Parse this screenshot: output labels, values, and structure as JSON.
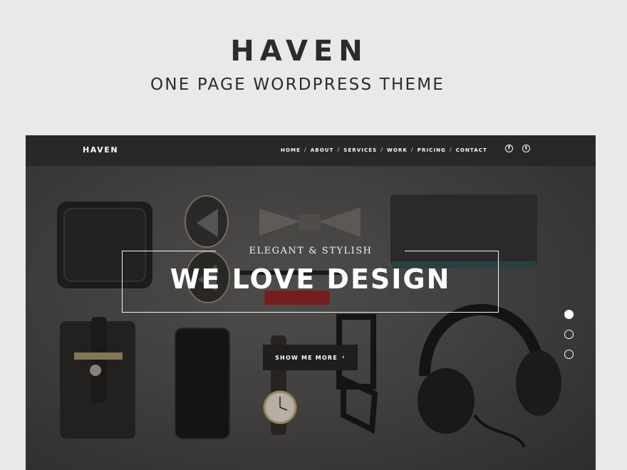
{
  "promo": {
    "title": "HAVEN",
    "subtitle": "ONE PAGE WORDPRESS THEME"
  },
  "site": {
    "logo": "HAVEN",
    "nav": {
      "items": [
        {
          "label": "HOME"
        },
        {
          "label": "ABOUT"
        },
        {
          "label": "SERVICES"
        },
        {
          "label": "WORK"
        },
        {
          "label": "PRICING"
        },
        {
          "label": "CONTACT"
        }
      ],
      "separator": "/"
    },
    "social": {
      "facebook_glyph": "f",
      "twitter_glyph": "t",
      "icons": [
        "facebook-icon",
        "twitter-icon"
      ]
    },
    "hero": {
      "tagline": "ELEGANT & STYLISH",
      "headline": "WE LOVE DESIGN",
      "cta_label": "SHOW ME MORE",
      "cta_chevron": "›",
      "slides": 3,
      "active_slide": 1
    }
  },
  "colors": {
    "page_background": "#e9e9e9",
    "heading_text": "#2b2b2b",
    "navbar": "#2a2827",
    "hero_base": "#4a4847",
    "button": "#1f1e1d",
    "text_light": "#ffffff"
  }
}
